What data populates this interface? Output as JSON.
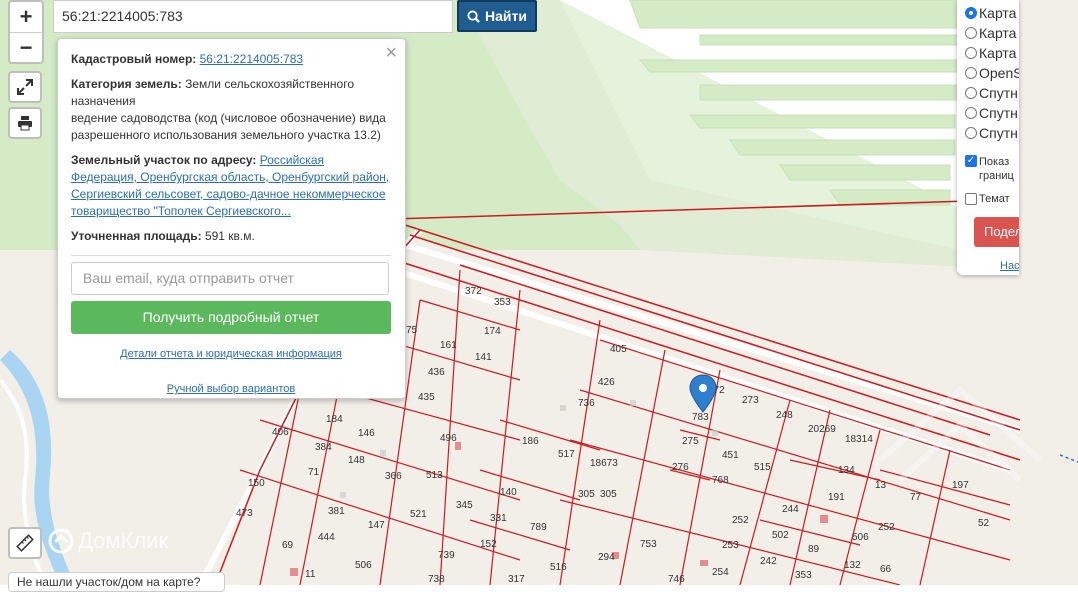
{
  "search": {
    "value": "56:21:2214005:783",
    "button_label": "Найти"
  },
  "zoom": {
    "in_label": "+",
    "out_label": "−"
  },
  "popup": {
    "close_label": "×",
    "cadastral_label": "Кадастровый номер:",
    "cadastral_value": "56:21:2214005:783",
    "category_label": "Категория земель:",
    "category_value_1": "Земли сельскохозяйственного назначения",
    "category_value_2": "ведение садоводства (код (числовое обозначение) вида разрешенного использования земельного участка 13.2)",
    "address_label": "Земельный участок по адресу:",
    "address_value": "Российская Федерация, Оренбургская область, Оренбургский район, Сергиевский сельсовет, садово-дачное некоммерческое товарищество \"Тополек Сергиевского...",
    "area_label": "Уточненная площадь:",
    "area_value": "591 кв.м.",
    "email_placeholder": "Ваш email, куда отправить отчет",
    "report_button": "Получить подробный отчет",
    "details_link": "Детали отчета и юридическая информация",
    "manual_link": "Ручной выбор вариантов"
  },
  "layers": {
    "options": [
      "Карта",
      "Карта",
      "Карта",
      "OpenS",
      "Спутн",
      "Спутн",
      "Спутн"
    ],
    "selected_index": 0,
    "checkbox_1": "Показ",
    "checkbox_1_line2": "границ",
    "checkbox_1_checked": true,
    "checkbox_2": "Темат",
    "checkbox_2_checked": false,
    "sections_button": "Подел",
    "settings_link": "Нас"
  },
  "watermark": "ДомКлик",
  "bottom_box": "Не нашли участок/дом на карте?",
  "marker_label": "783",
  "parcel_labels": [
    "372",
    "353",
    "174",
    "161",
    "141",
    "75",
    "436",
    "435",
    "406",
    "184",
    "146",
    "384",
    "148",
    "71",
    "366",
    "496",
    "513",
    "186",
    "517",
    "18673",
    "305",
    "305",
    "405",
    "426",
    "736",
    "273",
    "248",
    "20269",
    "18314",
    "275",
    "451",
    "515",
    "276",
    "768",
    "134",
    "13",
    "77",
    "197",
    "150",
    "473",
    "381",
    "147",
    "345",
    "331",
    "140",
    "789",
    "152",
    "521",
    "444",
    "69",
    "11",
    "506",
    "739",
    "738",
    "317",
    "516",
    "294",
    "753",
    "252",
    "244",
    "502",
    "191",
    "506",
    "52",
    "252",
    "253",
    "242",
    "89",
    "132",
    "746",
    "254",
    "353",
    "66",
    "772"
  ],
  "colors": {
    "parcel": "#d0191e",
    "road": "#e9e5dc",
    "green": "#d4ebc6",
    "water": "#a9d4f2",
    "button_blue": "#1f5c8f",
    "button_green": "#5cb85c",
    "button_red": "#d9534f"
  }
}
